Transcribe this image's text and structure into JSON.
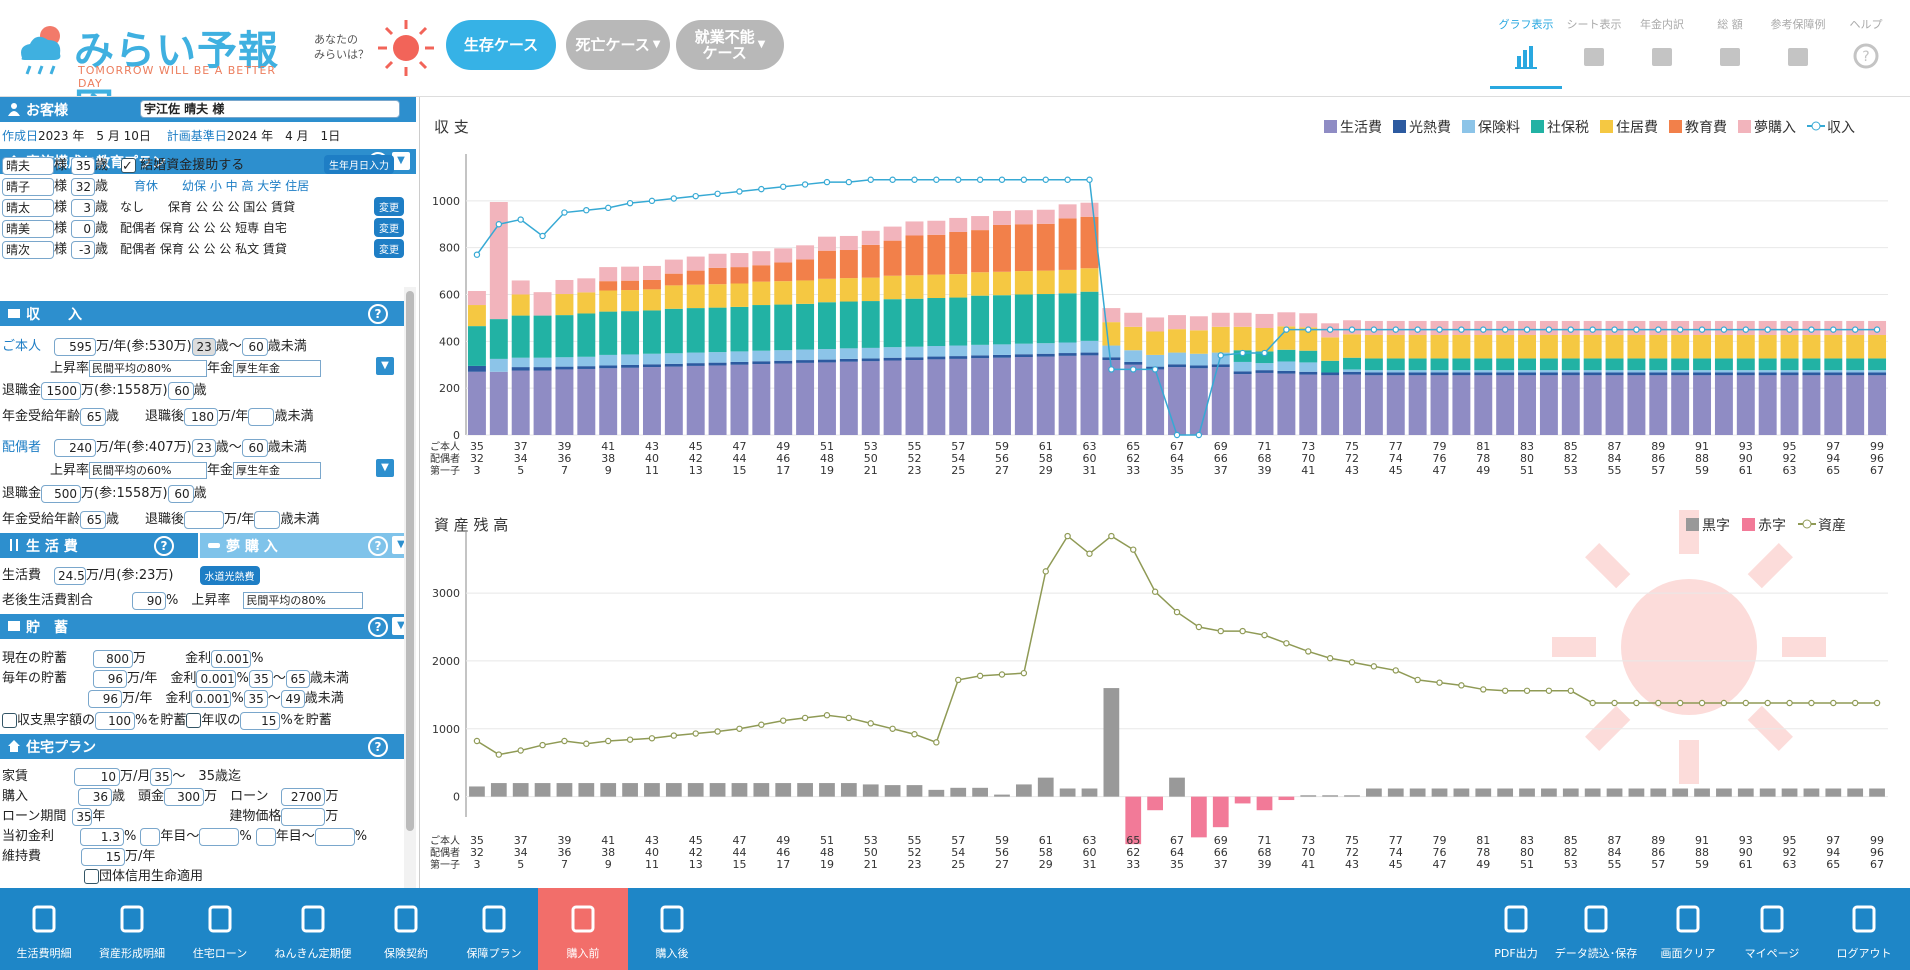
{
  "header": {
    "logo_title": "みらい予報図",
    "logo_sub": "TOMORROW WILL BE A BETTER DAY",
    "future_label": "あなたの\nみらいは？",
    "case_buttons": [
      {
        "label": "生存ケース"
      },
      {
        "label": "死亡ケース"
      },
      {
        "label": "就業不能\nケース"
      }
    ],
    "views": [
      {
        "label": "グラフ表示",
        "icon": "bar-chart-icon"
      },
      {
        "label": "シート表示",
        "icon": "sheet-grid-icon"
      },
      {
        "label": "年金内訳",
        "icon": "moneybag-icon"
      },
      {
        "label": "総 額",
        "icon": "bill-icon"
      },
      {
        "label": "参考保障例",
        "icon": "book-icon"
      },
      {
        "label": "ヘルプ",
        "icon": "help-icon"
      }
    ]
  },
  "customer": {
    "title": "お客様",
    "name": "宇江佐 晴夫 様",
    "created_label": "作成日",
    "created": "2023 年　5 月 10日",
    "base_label": "計画基準日",
    "base": "2024 年　4 月　1日"
  },
  "family": {
    "title": "家族構成と教育プラン",
    "checkbox": "結婚資金援助する",
    "birth_btn": "生年月日入力",
    "header": "育休　　幼保  小  中  高  大学  住居",
    "change": "変更",
    "members": [
      {
        "name": "晴夫",
        "suffix": "様",
        "age": "35",
        "unit": "歳",
        "plan": ""
      },
      {
        "name": "晴子",
        "suffix": "様",
        "age": "32",
        "unit": "歳",
        "plan": ""
      },
      {
        "name": "晴太",
        "suffix": "様",
        "age": "3",
        "unit": "歳",
        "plan": "なし　　保育  公  公  公  国公  賃貸"
      },
      {
        "name": "晴美",
        "suffix": "様",
        "age": "0",
        "unit": "歳",
        "plan": "配偶者  保育  公  公  公  短専  自宅"
      },
      {
        "name": "晴次",
        "suffix": "様",
        "age": "-3",
        "unit": "歳",
        "plan": "配偶者  保育  公  公  公  私文  賃貸"
      }
    ]
  },
  "income": {
    "title": "収　　入",
    "self": {
      "label": "ご本人",
      "amount": "595",
      "note": "万/年(参:530万)",
      "from": "23",
      "to": "60",
      "to_unit": "歳未満",
      "rise_label": "上昇率",
      "rise": "民間平均の80%",
      "pension_label": "年金",
      "pension": "厚生年金",
      "retire_label": "退職金",
      "retire": "1500",
      "retire_note": "万(参:1558万)",
      "retire_age": "60",
      "retire_age_unit": "歳",
      "pension_start_label": "年金受給年齢",
      "pension_start": "65",
      "after_label": "退職後",
      "after": "180",
      "after_unit": "万/年",
      "after_to": "",
      "after_to_unit": "歳未満"
    },
    "spouse": {
      "label": "配偶者",
      "amount": "240",
      "note": "万/年(参:407万)",
      "from": "23",
      "to": "60",
      "to_unit": "歳未満",
      "rise_label": "上昇率",
      "rise": "民間平均の60%",
      "pension_label": "年金",
      "pension": "厚生年金",
      "retire_label": "退職金",
      "retire": "500",
      "retire_note": "万(参:1558万)",
      "retire_age": "60",
      "retire_age_unit": "歳",
      "pension_start_label": "年金受給年齢",
      "pension_start": "65",
      "after_label": "退職後",
      "after": "",
      "after_unit": "万/年",
      "after_to": "",
      "after_to_unit": "歳未満"
    }
  },
  "living": {
    "title": "生 活 費",
    "dream_title": "夢 購 入",
    "cost_label": "生活費",
    "cost": "24.5",
    "cost_note": "万/月(参:23万)",
    "utility_btn": "水道光熱費",
    "old_label": "老後生活費割合",
    "old": "90",
    "old_unit": "%",
    "rise_label": "上昇率",
    "rise": "民間平均の80%"
  },
  "savings": {
    "title": "貯　蓄",
    "current_label": "現在の貯蓄",
    "current": "800",
    "current_unit": "万",
    "rate_label": "金利",
    "rate": "0.001",
    "rate_unit": "%",
    "yearly_label": "毎年の貯蓄",
    "yearly1": "96",
    "yearly2": "96",
    "yearly_unit": "万/年",
    "from1": "35",
    "to1": "65",
    "from2": "35",
    "to2": "49",
    "to_unit": "歳未満",
    "surplus_label": "収支黒字額の",
    "surplus": "100",
    "surplus_unit": "%を貯蓄",
    "income_label": "年収の",
    "income_pct": "15",
    "income_unit": "%を貯蓄"
  },
  "housing": {
    "title": "住宅プラン",
    "rent_label": "家賃",
    "rent": "10",
    "rent_unit": "万/月",
    "rent_from": "35",
    "rent_until": "35歳迄",
    "buy_label": "購入",
    "buy_age": "36",
    "buy_age_unit": "歳",
    "down_label": "頭金",
    "down": "300",
    "down_unit": "万",
    "loan_label": "ローン",
    "loan": "2700",
    "loan_unit": "万",
    "period_label": "ローン期間",
    "period": "35",
    "period_unit": "年",
    "bldg_label": "建物価格",
    "bldg_unit": "万",
    "init_rate_label": "当初金利",
    "init_rate": "1.3",
    "pct": "%",
    "year_from": "年目〜",
    "upkeep_label": "維持費",
    "upkeep": "15",
    "upkeep_unit": "万/年",
    "group_label": "団体信用生命適用"
  },
  "footer": {
    "left": [
      {
        "label": "生活費明細",
        "icon": "fork-spoon-icon"
      },
      {
        "label": "資産形成明細",
        "icon": "coin-stack-icon"
      },
      {
        "label": "住宅ローン",
        "icon": "house-icon"
      },
      {
        "label": "ねんきん定期便",
        "icon": "pension-seal-icon"
      },
      {
        "label": "保険契約",
        "icon": "hand-heart-icon"
      },
      {
        "label": "保障プラン",
        "icon": "heart-icon"
      },
      {
        "label": "購入前",
        "icon": "building-icon"
      },
      {
        "label": "購入後",
        "icon": "house-keys-icon"
      }
    ],
    "right": [
      {
        "label": "PDF出力",
        "icon": "pdf-icon"
      },
      {
        "label": "データ読込･保存",
        "icon": "database-icon"
      },
      {
        "label": "画面クリア",
        "icon": "trash-icon"
      },
      {
        "label": "マイページ",
        "icon": "id-card-icon"
      },
      {
        "label": "ログアウト",
        "icon": "logout-icon"
      }
    ]
  },
  "colors": {
    "living": "#8f8cc4",
    "utility": "#2c5aa0",
    "insurance": "#8cc4e8",
    "tax": "#22b2a4",
    "housing": "#f5c842",
    "education": "#f2804a",
    "dream": "#f2b4bc",
    "income": "#36a9d4",
    "black": "#999999",
    "red": "#f27a98",
    "asset": "#8f9a55"
  },
  "chart_data": [
    {
      "type": "bar",
      "title": "収 支",
      "legend": [
        "生活費",
        "光熱費",
        "保険料",
        "社保税",
        "住居費",
        "教育費",
        "夢購入",
        "収入"
      ],
      "ylim": [
        0,
        1200
      ],
      "yticks": [
        0,
        200,
        400,
        600,
        800,
        1000
      ],
      "x_rows": {
        "ご本人": [
          35,
          37,
          39,
          41,
          43,
          45,
          47,
          49,
          51,
          53,
          55,
          57,
          59,
          61,
          63,
          65,
          67,
          69,
          71,
          73,
          75,
          77,
          79,
          81,
          83,
          85,
          87,
          89,
          91,
          93,
          95,
          97,
          99
        ],
        "配偶者": [
          32,
          34,
          36,
          38,
          40,
          42,
          44,
          46,
          48,
          50,
          52,
          54,
          56,
          58,
          60,
          62,
          64,
          66,
          68,
          70,
          72,
          74,
          76,
          78,
          80,
          82,
          84,
          86,
          88,
          90,
          92,
          94,
          96
        ],
        "第一子": [
          3,
          5,
          7,
          9,
          11,
          13,
          15,
          17,
          19,
          21,
          23,
          25,
          27,
          29,
          31,
          33,
          35,
          37,
          39,
          41,
          43,
          45,
          47,
          49,
          51,
          53,
          55,
          57,
          59,
          61,
          63,
          65,
          67
        ]
      },
      "stacks": [
        [
          270,
          270,
          275,
          275,
          280,
          282,
          285,
          287,
          290,
          292,
          295,
          297,
          300,
          303,
          305,
          308,
          310,
          313,
          315,
          318,
          320,
          323,
          325,
          328,
          330,
          333,
          335,
          338,
          340,
          320,
          300,
          280,
          290,
          285,
          290,
          260,
          265,
          262,
          258,
          255,
          258,
          255,
          255,
          255,
          255,
          255,
          255,
          255,
          255,
          255,
          255,
          255,
          255,
          255,
          255,
          255,
          255,
          255,
          255,
          255,
          255,
          255,
          255,
          255,
          255
        ],
        [
          25,
          0,
          15,
          15,
          12,
          12,
          12,
          12,
          12,
          12,
          12,
          12,
          12,
          12,
          12,
          12,
          12,
          12,
          12,
          12,
          12,
          12,
          12,
          12,
          12,
          12,
          12,
          12,
          12,
          12,
          12,
          12,
          12,
          12,
          12,
          12,
          12,
          12,
          12,
          12,
          12,
          12,
          12,
          12,
          12,
          12,
          12,
          12,
          12,
          12,
          12,
          12,
          12,
          12,
          12,
          12,
          12,
          12,
          12,
          12,
          12,
          12,
          12,
          12,
          12
        ],
        [
          0,
          55,
          40,
          40,
          40,
          40,
          45,
          45,
          45,
          45,
          45,
          45,
          45,
          45,
          45,
          45,
          45,
          45,
          45,
          45,
          45,
          45,
          45,
          45,
          45,
          45,
          45,
          45,
          50,
          50,
          50,
          50,
          50,
          50,
          50,
          40,
          30,
          40,
          40,
          0,
          10,
          10,
          10,
          10,
          10,
          10,
          10,
          10,
          10,
          10,
          10,
          10,
          10,
          10,
          10,
          10,
          10,
          10,
          10,
          10,
          10,
          10,
          10,
          10,
          10
        ],
        [
          170,
          170,
          180,
          180,
          180,
          185,
          185,
          185,
          185,
          190,
          190,
          190,
          190,
          195,
          195,
          195,
          200,
          200,
          200,
          205,
          205,
          205,
          205,
          210,
          210,
          210,
          210,
          210,
          210,
          0,
          0,
          0,
          0,
          0,
          0,
          50,
          50,
          50,
          50,
          50,
          50,
          50,
          50,
          50,
          50,
          50,
          50,
          50,
          50,
          50,
          50,
          50,
          50,
          50,
          50,
          50,
          50,
          50,
          50,
          50,
          50,
          50,
          50,
          50,
          50
        ],
        [
          90,
          0,
          90,
          0,
          90,
          90,
          90,
          90,
          90,
          100,
          100,
          100,
          100,
          100,
          100,
          100,
          100,
          100,
          100,
          100,
          100,
          100,
          100,
          100,
          100,
          100,
          100,
          100,
          100,
          100,
          100,
          100,
          100,
          100,
          110,
          100,
          100,
          100,
          100,
          100,
          100,
          100,
          100,
          100,
          100,
          100,
          100,
          100,
          100,
          100,
          100,
          100,
          100,
          100,
          100,
          100,
          100,
          100,
          100,
          100,
          100,
          100,
          100,
          100,
          100
        ],
        [
          0,
          0,
          0,
          0,
          0,
          0,
          40,
          40,
          40,
          50,
          60,
          70,
          70,
          70,
          80,
          90,
          120,
          120,
          140,
          150,
          170,
          170,
          180,
          180,
          200,
          200,
          200,
          220,
          220,
          0,
          0,
          0,
          0,
          0,
          0,
          0,
          0,
          0,
          0,
          0,
          0,
          0,
          0,
          0,
          0,
          0,
          0,
          0,
          0,
          0,
          0,
          0,
          0,
          0,
          0,
          0,
          0,
          0,
          0,
          0,
          0,
          0,
          0,
          0,
          0
        ],
        [
          60,
          500,
          60,
          100,
          60,
          60,
          60,
          60,
          60,
          60,
          60,
          60,
          60,
          60,
          60,
          60,
          60,
          60,
          60,
          60,
          60,
          60,
          60,
          60,
          60,
          60,
          60,
          60,
          60,
          60,
          60,
          60,
          60,
          60,
          60,
          60,
          60,
          60,
          60,
          60,
          60,
          60,
          60,
          60,
          60,
          60,
          60,
          60,
          60,
          60,
          60,
          60,
          60,
          60,
          60,
          60,
          60,
          60,
          60,
          60,
          60,
          60,
          60,
          60,
          60
        ]
      ],
      "income": [
        770,
        900,
        920,
        850,
        950,
        960,
        970,
        990,
        1000,
        1010,
        1020,
        1030,
        1040,
        1050,
        1060,
        1070,
        1080,
        1080,
        1090,
        1090,
        1090,
        1090,
        1090,
        1090,
        1090,
        1090,
        1090,
        1090,
        1090,
        280,
        280,
        280,
        0,
        0,
        340,
        350,
        350,
        450,
        450,
        450,
        450,
        450,
        450,
        450,
        450,
        450,
        450,
        450,
        450,
        450,
        450,
        450,
        450,
        450,
        450,
        450,
        450,
        450,
        450,
        450,
        450,
        450,
        450,
        450,
        450
      ]
    },
    {
      "type": "line+bar",
      "title": "資 産 残 高",
      "legend": [
        "黒字",
        "赤字",
        "資産"
      ],
      "ylim": [
        -300,
        3900
      ],
      "yticks": [
        0,
        1000,
        2000,
        3000
      ],
      "assets": [
        820,
        620,
        680,
        760,
        820,
        780,
        820,
        840,
        860,
        900,
        930,
        960,
        1000,
        1060,
        1120,
        1160,
        1200,
        1160,
        1080,
        1000,
        920,
        800,
        1720,
        1780,
        1800,
        1820,
        3320,
        3840,
        3580,
        3840,
        3640,
        3020,
        2720,
        2500,
        2440,
        2440,
        2380,
        2260,
        2140,
        2040,
        1980,
        1920,
        1860,
        1720,
        1680,
        1640,
        1580,
        1560,
        1560,
        1560,
        1560,
        1380,
        1380,
        1380,
        1380,
        1380,
        1380,
        1380,
        1380,
        1380,
        1380,
        1380,
        1380,
        1380,
        1380
      ],
      "flows": [
        150,
        200,
        200,
        200,
        200,
        200,
        200,
        200,
        200,
        200,
        200,
        200,
        200,
        200,
        200,
        200,
        200,
        200,
        180,
        170,
        170,
        100,
        130,
        130,
        30,
        180,
        280,
        120,
        120,
        1600,
        -700,
        -200,
        280,
        -600,
        -450,
        -100,
        -200,
        -50,
        20,
        20,
        20,
        120,
        120,
        120,
        120,
        120,
        120,
        120,
        120,
        120,
        120,
        120,
        120,
        120,
        120,
        120,
        120,
        120,
        120,
        120,
        120,
        120,
        120,
        120,
        120
      ]
    }
  ]
}
